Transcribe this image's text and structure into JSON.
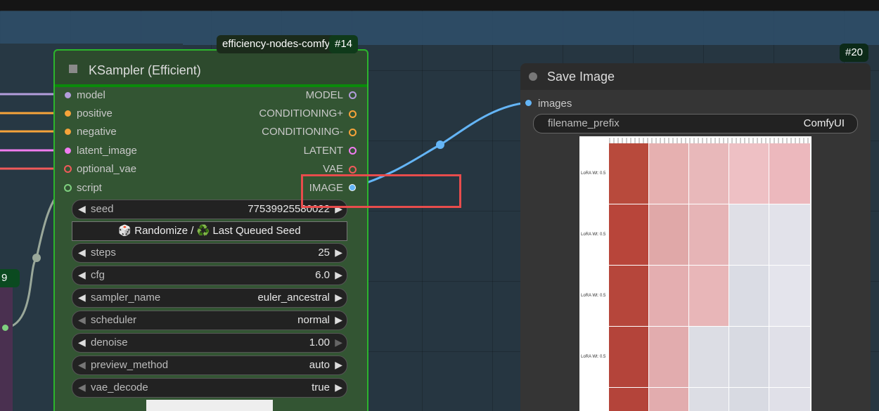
{
  "ksampler": {
    "group_label": "efficiency-nodes-comfyui",
    "id": "#14",
    "title": "KSampler (Efficient)",
    "inputs": [
      {
        "name": "model",
        "color": "#b39ddb"
      },
      {
        "name": "positive",
        "color": "#f6a33a"
      },
      {
        "name": "negative",
        "color": "#f6a33a"
      },
      {
        "name": "latent_image",
        "color": "#f07cf0"
      },
      {
        "name": "optional_vae",
        "color": "#f05a5a"
      },
      {
        "name": "script",
        "color": "#7fd07f"
      }
    ],
    "outputs": [
      {
        "name": "MODEL",
        "color": "#b39ddb"
      },
      {
        "name": "CONDITIONING+",
        "color": "#f6a33a"
      },
      {
        "name": "CONDITIONING-",
        "color": "#f6a33a"
      },
      {
        "name": "LATENT",
        "color": "#f07cf0"
      },
      {
        "name": "VAE",
        "color": "#f05a5a"
      },
      {
        "name": "IMAGE",
        "color": "#64b5f6"
      }
    ],
    "widgets": {
      "seed": {
        "label": "seed",
        "value": "77539925580022"
      },
      "randomize_btn": "🎲 Randomize / ♻️ Last Queued Seed",
      "steps": {
        "label": "steps",
        "value": "25"
      },
      "cfg": {
        "label": "cfg",
        "value": "6.0"
      },
      "sampler_name": {
        "label": "sampler_name",
        "value": "euler_ancestral"
      },
      "scheduler": {
        "label": "scheduler",
        "value": "normal"
      },
      "denoise": {
        "label": "denoise",
        "value": "1.00"
      },
      "preview_method": {
        "label": "preview_method",
        "value": "auto"
      },
      "vae_decode": {
        "label": "vae_decode",
        "value": "true"
      }
    }
  },
  "save_image": {
    "id": "#20",
    "title": "Save Image",
    "input": "images",
    "filename_prefix": {
      "label": "filename_prefix",
      "value": "ComfyUI"
    }
  },
  "left_node": {
    "id": "9"
  },
  "preview_grid": {
    "row_labels": [
      "LoRA Wt: 0.5",
      "LoRA Wt: 0.5",
      "LoRA Wt: 0.5",
      "LoRA Wt: 0.5"
    ]
  }
}
